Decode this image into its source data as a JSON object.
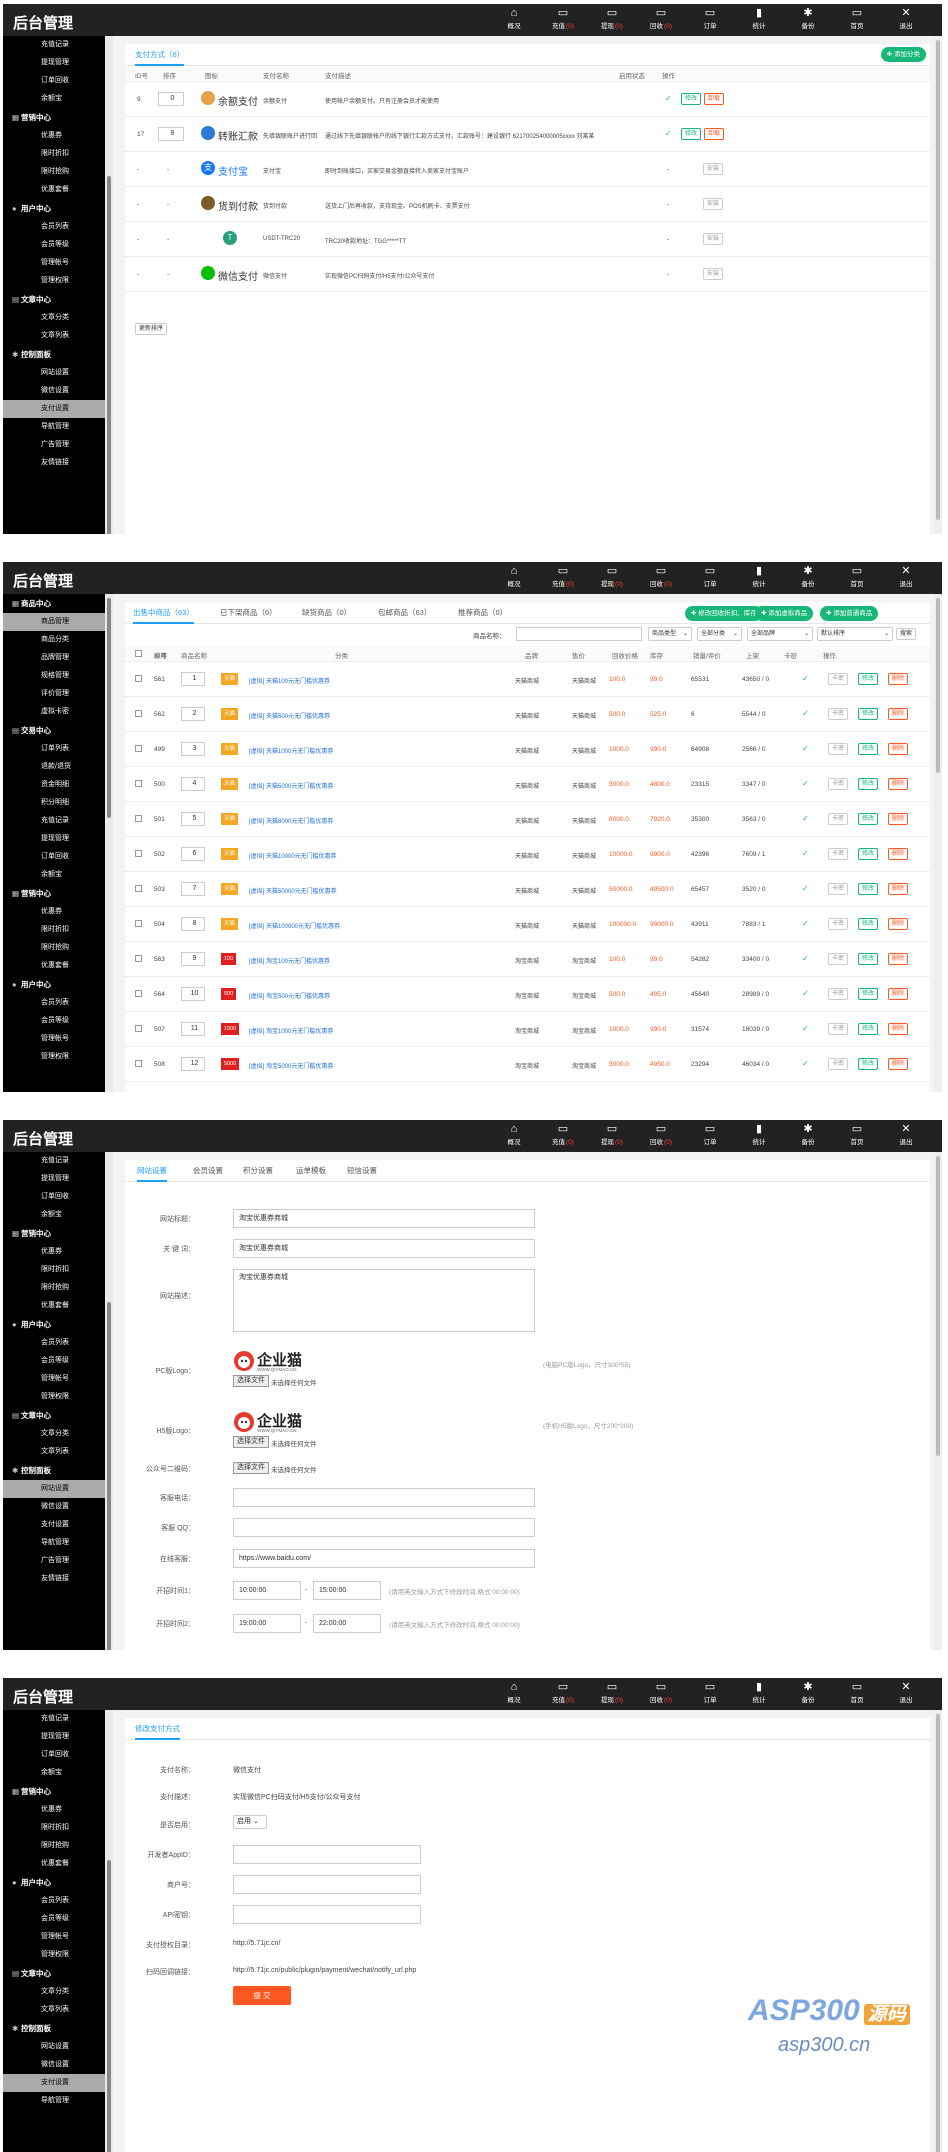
{
  "app_title": "后台管理",
  "topnav": [
    {
      "label": "概况",
      "icon": "home-icon",
      "badge": ""
    },
    {
      "label": "充值",
      "icon": "monitor-icon",
      "badge": "(0)"
    },
    {
      "label": "提现",
      "icon": "monitor-icon",
      "badge": "(0)"
    },
    {
      "label": "回收",
      "icon": "monitor-icon",
      "badge": "(0)"
    },
    {
      "label": "订单",
      "icon": "monitor-icon",
      "badge": ""
    },
    {
      "label": "统计",
      "icon": "bar-chart-icon",
      "badge": ""
    },
    {
      "label": "备份",
      "icon": "gear-icon",
      "badge": ""
    },
    {
      "label": "首页",
      "icon": "monitor-icon",
      "badge": ""
    },
    {
      "label": "退出",
      "icon": "close-icon",
      "badge": ""
    }
  ],
  "panel1": {
    "sidebar": [
      {
        "t": "i",
        "label": "充值记录"
      },
      {
        "t": "i",
        "label": "提现管理"
      },
      {
        "t": "i",
        "label": "订单回收"
      },
      {
        "t": "i",
        "label": "余额宝"
      },
      {
        "t": "g",
        "label": "营销中心",
        "icon": "grid-icon"
      },
      {
        "t": "i",
        "label": "优惠券"
      },
      {
        "t": "i",
        "label": "限时折扣"
      },
      {
        "t": "i",
        "label": "限时抢购"
      },
      {
        "t": "i",
        "label": "优惠套餐"
      },
      {
        "t": "g",
        "label": "用户中心",
        "icon": "user-icon"
      },
      {
        "t": "i",
        "label": "会员列表"
      },
      {
        "t": "i",
        "label": "会员等级"
      },
      {
        "t": "i",
        "label": "管理帐号"
      },
      {
        "t": "i",
        "label": "管理权限"
      },
      {
        "t": "g",
        "label": "文章中心",
        "icon": "doc-icon"
      },
      {
        "t": "i",
        "label": "文章分类"
      },
      {
        "t": "i",
        "label": "文章列表"
      },
      {
        "t": "g",
        "label": "控制面板",
        "icon": "gear-icon"
      },
      {
        "t": "i",
        "label": "网站设置"
      },
      {
        "t": "i",
        "label": "微信设置"
      },
      {
        "t": "i",
        "label": "支付设置",
        "active": true
      },
      {
        "t": "i",
        "label": "导航管理"
      },
      {
        "t": "i",
        "label": "广告管理"
      },
      {
        "t": "i",
        "label": "友情链接"
      }
    ],
    "tab": "支付方式（6）",
    "add_button": "添加分类",
    "headers": [
      "ID号",
      "排序",
      "图标",
      "支付名称",
      "支付描述",
      "启用状态",
      "操作"
    ],
    "rows": [
      {
        "id": "9",
        "sort": "0",
        "icon_name": "余额支付",
        "icon": "coin-icon",
        "color": "#e7a14b",
        "name": "余额支付",
        "desc": "使用帐户余额支付。只有注册会员才能使用",
        "enabled": true,
        "actions": [
          "修改",
          "卸载"
        ]
      },
      {
        "id": "17",
        "sort": "8",
        "icon_name": "转账汇款",
        "icon": "transfer-icon",
        "color": "#2a7bd6",
        "name": "先填银联账户进行回",
        "desc": "通过线下先填银联帐户的线下银行汇款方式支付。汇款账号：建设银行 621700254000005xxxx 刘某某",
        "enabled": true,
        "actions": [
          "修改",
          "卸载"
        ]
      },
      {
        "id": "-",
        "sort": "-",
        "icon_name": "支付宝",
        "icon": "alipay-icon",
        "color": "#1677ff",
        "name": "支付宝",
        "desc": "即时到账接口，买家交易金额直接转入卖家支付宝账户",
        "enabled": false,
        "actions": [
          "安装"
        ]
      },
      {
        "id": "-",
        "sort": "-",
        "icon_name": "货到付款",
        "icon": "truck-icon",
        "color": "#7a5b2a",
        "name": "货到付款",
        "desc": "送货上门后再收款，支持现金、POS机刷卡、支票支付",
        "enabled": false,
        "actions": [
          "安装"
        ]
      },
      {
        "id": "-",
        "sort": "-",
        "icon_name": "",
        "icon": "tether-icon",
        "color": "#26a17b",
        "name": "USDT-TRC20",
        "desc": "TRC20收款地址：TGG*****TT",
        "enabled": false,
        "actions": [
          "安装"
        ]
      },
      {
        "id": "-",
        "sort": "-",
        "icon_name": "微信支付",
        "icon": "wechat-icon",
        "color": "#09bb07",
        "name": "微信支付",
        "desc": "实现微信PC扫码支付/H5支付/公众号支付",
        "enabled": false,
        "actions": [
          "安装"
        ]
      }
    ],
    "update_sort": "更新排序"
  },
  "panel2": {
    "sidebar": [
      {
        "t": "g",
        "label": "商品中心",
        "icon": "grid-icon"
      },
      {
        "t": "i",
        "label": "商品管理",
        "active": true
      },
      {
        "t": "i",
        "label": "商品分类"
      },
      {
        "t": "i",
        "label": "品牌管理"
      },
      {
        "t": "i",
        "label": "规格管理"
      },
      {
        "t": "i",
        "label": "评价管理"
      },
      {
        "t": "i",
        "label": "虚拟卡密"
      },
      {
        "t": "g",
        "label": "交易中心",
        "icon": "doc-icon"
      },
      {
        "t": "i",
        "label": "订单列表"
      },
      {
        "t": "i",
        "label": "退款/退货"
      },
      {
        "t": "i",
        "label": "资金明细"
      },
      {
        "t": "i",
        "label": "积分明细"
      },
      {
        "t": "i",
        "label": "充值记录"
      },
      {
        "t": "i",
        "label": "提现管理"
      },
      {
        "t": "i",
        "label": "订单回收"
      },
      {
        "t": "i",
        "label": "余额宝"
      },
      {
        "t": "g",
        "label": "营销中心",
        "icon": "grid-icon"
      },
      {
        "t": "i",
        "label": "优惠券"
      },
      {
        "t": "i",
        "label": "限时折扣"
      },
      {
        "t": "i",
        "label": "限时抢购"
      },
      {
        "t": "i",
        "label": "优惠套餐"
      },
      {
        "t": "g",
        "label": "用户中心",
        "icon": "user-icon"
      },
      {
        "t": "i",
        "label": "会员列表"
      },
      {
        "t": "i",
        "label": "会员等级"
      },
      {
        "t": "i",
        "label": "管理帐号"
      },
      {
        "t": "i",
        "label": "管理权限"
      }
    ],
    "tabs": [
      "出售中商品（63）",
      "已下架商品（0）",
      "缺货商品（0）",
      "包邮商品（63）",
      "推荐商品（0）"
    ],
    "buttons": [
      "修改回收折扣、库存",
      "添加虚拟商品",
      "添加普通商品"
    ],
    "search_label": "商品名称：",
    "filters": [
      "商品类型",
      "全部分类",
      "全部品牌",
      "默认排序"
    ],
    "search_btn": "搜索",
    "headers": [
      "ID号",
      "排序",
      "商品名称",
      "分类",
      "品牌",
      "售价",
      "回收价格",
      "库存",
      "销量/评价",
      "上架",
      "卡密",
      "操作"
    ],
    "rows": [
      {
        "id": "561",
        "sort": "1",
        "thumb": "天猫",
        "name": "[虚拟] 天猫100元无门槛优惠券",
        "cat": "天猫商城",
        "brand": "天猫商城",
        "price": "100.0",
        "rec": "99.0",
        "stock": "65531",
        "sales": "43650 / 0"
      },
      {
        "id": "562",
        "sort": "2",
        "thumb": "天猫",
        "name": "[虚拟] 天猫500元无门槛优惠券",
        "cat": "天猫商城",
        "brand": "天猫商城",
        "price": "500.0",
        "rec": "525.0",
        "stock": "6",
        "sales": "5544 / 0"
      },
      {
        "id": "499",
        "sort": "3",
        "thumb": "天猫",
        "name": "[虚拟] 天猫1000元无门槛优惠券",
        "cat": "天猫商城",
        "brand": "天猫商城",
        "price": "1000.0",
        "rec": "990.0",
        "stock": "64908",
        "sales": "2566 / 0"
      },
      {
        "id": "500",
        "sort": "4",
        "thumb": "天猫",
        "name": "[虚拟] 天猫5000元无门槛优惠券",
        "cat": "天猫商城",
        "brand": "天猫商城",
        "price": "5000.0",
        "rec": "4800.0",
        "stock": "23315",
        "sales": "3347 / 0"
      },
      {
        "id": "501",
        "sort": "5",
        "thumb": "天猫",
        "name": "[虚拟] 天猫8000元无门槛优惠券",
        "cat": "天猫商城",
        "brand": "天猫商城",
        "price": "8000.0",
        "rec": "7920.0",
        "stock": "35300",
        "sales": "3563 / 0"
      },
      {
        "id": "502",
        "sort": "6",
        "thumb": "天猫",
        "name": "[虚拟] 天猫10000元无门槛优惠券",
        "cat": "天猫商城",
        "brand": "天猫商城",
        "price": "10000.0",
        "rec": "9900.0",
        "stock": "42396",
        "sales": "7609 / 1"
      },
      {
        "id": "503",
        "sort": "7",
        "thumb": "天猫",
        "name": "[虚拟] 天猫50000元无门槛优惠券",
        "cat": "天猫商城",
        "brand": "天猫商城",
        "price": "50000.0",
        "rec": "49500.0",
        "stock": "65457",
        "sales": "3520 / 0"
      },
      {
        "id": "504",
        "sort": "8",
        "thumb": "天猫",
        "name": "[虚拟] 天猫100000元无门槛优惠券",
        "cat": "天猫商城",
        "brand": "天猫商城",
        "price": "100000.0",
        "rec": "99000.0",
        "stock": "43911",
        "sales": "7883 / 1"
      },
      {
        "id": "563",
        "sort": "9",
        "thumb": "100",
        "name": "[虚拟] 淘宝100元无门槛优惠券",
        "cat": "淘宝商城",
        "brand": "淘宝商城",
        "price": "100.0",
        "rec": "99.0",
        "stock": "54282",
        "sales": "33400 / 0"
      },
      {
        "id": "564",
        "sort": "10",
        "thumb": "500",
        "name": "[虚拟] 淘宝500元无门槛优惠券",
        "cat": "淘宝商城",
        "brand": "淘宝商城",
        "price": "500.0",
        "rec": "495.0",
        "stock": "45640",
        "sales": "28989 / 0"
      },
      {
        "id": "507",
        "sort": "11",
        "thumb": "1000",
        "name": "[虚拟] 淘宝1000元无门槛优惠券",
        "cat": "淘宝商城",
        "brand": "淘宝商城",
        "price": "1000.0",
        "rec": "990.0",
        "stock": "31574",
        "sales": "18039 / 0"
      },
      {
        "id": "508",
        "sort": "12",
        "thumb": "5000",
        "name": "[虚拟] 淘宝5000元无门槛优惠券",
        "cat": "淘宝商城",
        "brand": "淘宝商城",
        "price": "5000.0",
        "rec": "4950.0",
        "stock": "23294",
        "sales": "46034 / 0"
      }
    ],
    "row_buttons": [
      "卡密",
      "修改",
      "删除"
    ]
  },
  "panel3": {
    "sidebar": [
      {
        "t": "i",
        "label": "充值记录"
      },
      {
        "t": "i",
        "label": "提现管理"
      },
      {
        "t": "i",
        "label": "订单回收"
      },
      {
        "t": "i",
        "label": "余额宝"
      },
      {
        "t": "g",
        "label": "营销中心",
        "icon": "grid-icon"
      },
      {
        "t": "i",
        "label": "优惠券"
      },
      {
        "t": "i",
        "label": "限时折扣"
      },
      {
        "t": "i",
        "label": "限时抢购"
      },
      {
        "t": "i",
        "label": "优惠套餐"
      },
      {
        "t": "g",
        "label": "用户中心",
        "icon": "user-icon"
      },
      {
        "t": "i",
        "label": "会员列表"
      },
      {
        "t": "i",
        "label": "会员等级"
      },
      {
        "t": "i",
        "label": "管理帐号"
      },
      {
        "t": "i",
        "label": "管理权限"
      },
      {
        "t": "g",
        "label": "文章中心",
        "icon": "doc-icon"
      },
      {
        "t": "i",
        "label": "文章分类"
      },
      {
        "t": "i",
        "label": "文章列表"
      },
      {
        "t": "g",
        "label": "控制面板",
        "icon": "gear-icon"
      },
      {
        "t": "i",
        "label": "网站设置",
        "active": true
      },
      {
        "t": "i",
        "label": "微信设置"
      },
      {
        "t": "i",
        "label": "支付设置"
      },
      {
        "t": "i",
        "label": "导航管理"
      },
      {
        "t": "i",
        "label": "广告管理"
      },
      {
        "t": "i",
        "label": "友情链接"
      }
    ],
    "tabs": [
      "网站设置",
      "会员设置",
      "积分设置",
      "运单模板",
      "短信设置"
    ],
    "site_title_label": "网站标题：",
    "site_title": "淘宝优惠券商城",
    "keywords_label": "关 键 词：",
    "keywords": "淘宝优惠券商城",
    "desc_label": "网站描述：",
    "desc": "淘宝优惠券商城",
    "pc_logo_label": "PC版Logo：",
    "pc_logo_hint": "(电脑PC版Logo，尺寸300*55)",
    "h5_logo_label": "H5版Logo：",
    "h5_logo_hint": "(手机H5版Logo，尺寸200*200)",
    "logo_text": "企业猫",
    "logo_url": "WWW.QIYMAO.CN",
    "file_btn": "选择文件",
    "file_none": "未选择任何文件",
    "qr_label": "公众号二维码：",
    "phone_label": "客服电话：",
    "qq_label": "客服 QQ：",
    "chat_label": "在线客服：",
    "chat_value": "https://www.baidu.com/",
    "open1_label": "开招时间1：",
    "open1_a": "10:00:00",
    "open1_b": "15:00:00",
    "open2_label": "开招时间2：",
    "open2_a": "19:00:00",
    "open2_b": "22:00:00",
    "time_hint": "(请用英文输入方式下修改时间,格式 00:00:00)",
    "dash": "-"
  },
  "panel4": {
    "sidebar": [
      {
        "t": "i",
        "label": "充值记录"
      },
      {
        "t": "i",
        "label": "提现管理"
      },
      {
        "t": "i",
        "label": "订单回收"
      },
      {
        "t": "i",
        "label": "余额宝"
      },
      {
        "t": "g",
        "label": "营销中心",
        "icon": "grid-icon"
      },
      {
        "t": "i",
        "label": "优惠券"
      },
      {
        "t": "i",
        "label": "限时折扣"
      },
      {
        "t": "i",
        "label": "限时抢购"
      },
      {
        "t": "i",
        "label": "优惠套餐"
      },
      {
        "t": "g",
        "label": "用户中心",
        "icon": "user-icon"
      },
      {
        "t": "i",
        "label": "会员列表"
      },
      {
        "t": "i",
        "label": "会员等级"
      },
      {
        "t": "i",
        "label": "管理帐号"
      },
      {
        "t": "i",
        "label": "管理权限"
      },
      {
        "t": "g",
        "label": "文章中心",
        "icon": "doc-icon"
      },
      {
        "t": "i",
        "label": "文章分类"
      },
      {
        "t": "i",
        "label": "文章列表"
      },
      {
        "t": "g",
        "label": "控制面板",
        "icon": "gear-icon"
      },
      {
        "t": "i",
        "label": "网站设置"
      },
      {
        "t": "i",
        "label": "微信设置"
      },
      {
        "t": "i",
        "label": "支付设置",
        "active": true
      },
      {
        "t": "i",
        "label": "导航管理"
      }
    ],
    "tab": "修改支付方式",
    "name_label": "支付名称：",
    "name": "微信支付",
    "desc_label": "支付描述：",
    "desc": "实现微信PC扫码支付/H5支付/公众号支付",
    "enable_label": "是否启用：",
    "enable": "启用",
    "appid_label": "开发者AppID：",
    "merchant_label": "商户号：",
    "key_label": "API密钥：",
    "auth_label": "支付授权目录：",
    "auth": "http://5.71jc.cn/",
    "notify_label": "扫码回调链接：",
    "notify": "http://5.71jc.cn/public/plugin/payment/wechat/notify_url.php",
    "submit": "提 交"
  },
  "watermark": {
    "brand": "ASP300",
    "brand_cn": "源码",
    "url": "asp300.cn"
  }
}
